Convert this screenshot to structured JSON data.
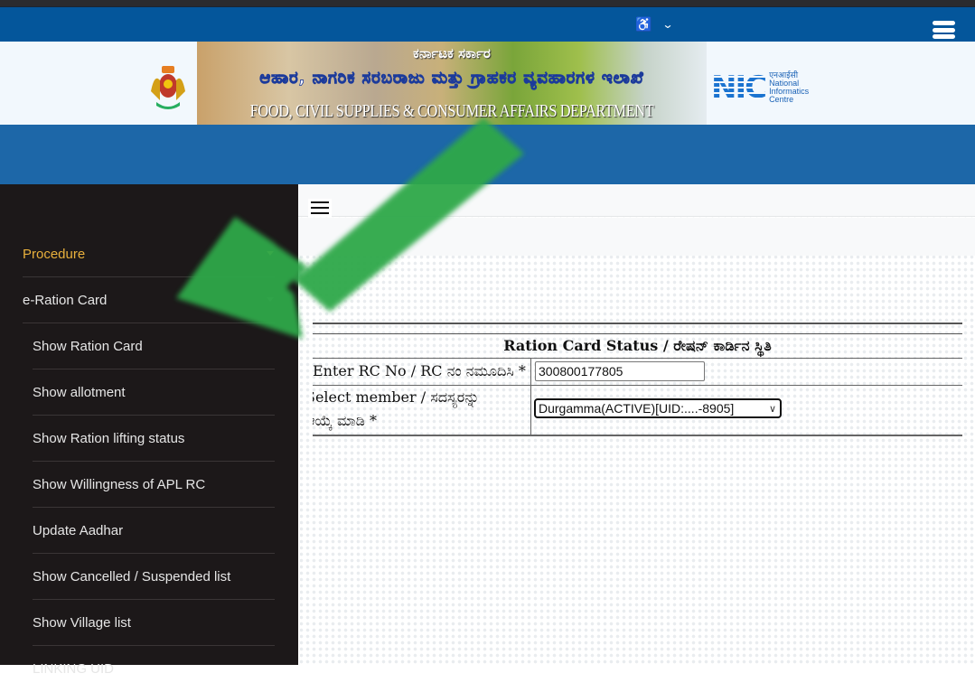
{
  "header": {
    "accessibility_icon": "wheelchair-icon",
    "accessibility_dropdown_icon": "chevron-down-icon",
    "menu_icon": "hamburger-icon"
  },
  "banner": {
    "line1": "ಕರ್ನಾಟಕ ಸರ್ಕಾರ",
    "line2": "ಆಹಾರ, ನಾಗರಿಕ ಸರಬರಾಜು ಮತ್ತು ಗ್ರಾಹಕರ ವ್ಯವಹಾರಗಳ ಇಲಾಖೆ",
    "line3": "FOOD, CIVIL SUPPLIES & CONSUMER AFFAIRS DEPARTMENT",
    "nic_logo": "NIC",
    "nic_hindi": "एनआईसी",
    "nic_line1": "National",
    "nic_line2": "Informatics",
    "nic_line3": "Centre"
  },
  "sidebar": {
    "items": [
      {
        "label": "Procedure",
        "active": true,
        "has_caret": true
      },
      {
        "label": "e-Ration Card",
        "active": false,
        "has_caret": true
      },
      {
        "label": "Show Ration Card"
      },
      {
        "label": "Show allotment"
      },
      {
        "label": "Show Ration lifting status"
      },
      {
        "label": "Show Willingness of APL RC"
      },
      {
        "label": "Update Aadhar"
      },
      {
        "label": "Show Cancelled / Suspended list"
      },
      {
        "label": "Show Village list"
      },
      {
        "label": "LINKING UID"
      }
    ]
  },
  "form": {
    "title": "Ration Card Status / ರೇಷನ್ ಕಾರ್ಡಿನ ಸ್ಥಿತಿ",
    "rc_label": "Enter RC No / RC ನಂ ನಮೂದಿಸಿ *",
    "rc_value": "300800177805",
    "member_label_line1": "Select member / ಸದಸ್ಯರನ್ನು",
    "member_label_line2": "ಆಯ್ಕೆ ಮಾಡಿ *",
    "member_selected": "Durgamma(ACTIVE)[UID:....-8905]"
  },
  "colors": {
    "topbar": "#04569b",
    "band": "#1d67a8",
    "sidebar_bg": "#1c1819",
    "active_item": "#e8b03c",
    "annotation_arrow": "#2ea84a"
  }
}
